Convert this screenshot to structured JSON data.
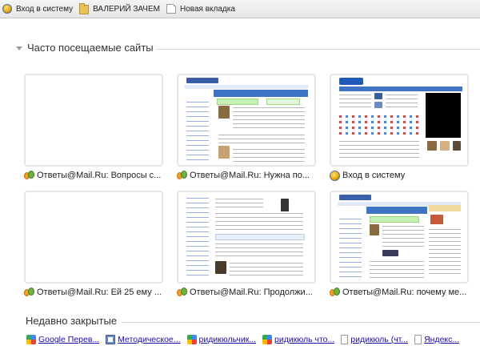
{
  "bookmarks": [
    {
      "label": "Вход в систему",
      "icon": "login-icon"
    },
    {
      "label": "ВАЛЕРИЙ ЗАЧЕМ",
      "icon": "folder-icon"
    },
    {
      "label": "Новая вкладка",
      "icon": "page-icon"
    }
  ],
  "most_visited": {
    "title": "Часто посещаемые сайты",
    "tiles": [
      {
        "label": "Ответы@Mail.Ru: Вопросы с...",
        "icon": "otvety-icon",
        "thumb": "blank"
      },
      {
        "label": "Ответы@Mail.Ru: Нужна по...",
        "icon": "otvety-icon",
        "thumb": "otvety"
      },
      {
        "label": "Вход в систему",
        "icon": "login-icon",
        "thumb": "mailru"
      },
      {
        "label": "Ответы@Mail.Ru: Ей 25 ему ...",
        "icon": "otvety-icon",
        "thumb": "blank"
      },
      {
        "label": "Ответы@Mail.Ru: Продолжи...",
        "icon": "otvety-icon",
        "thumb": "otvety2"
      },
      {
        "label": "Ответы@Mail.Ru: почему ме...",
        "icon": "otvety-icon",
        "thumb": "otvety3"
      }
    ]
  },
  "recently_closed": {
    "title": "Недавно закрытые",
    "items": [
      {
        "label": "Google Перев...",
        "icon": "google-icon"
      },
      {
        "label": "Методическое...",
        "icon": "document-icon"
      },
      {
        "label": "ридикюльчик...",
        "icon": "google-icon"
      },
      {
        "label": "ридикюль что...",
        "icon": "google-icon"
      },
      {
        "label": "ридикюль (чт...",
        "icon": "page-icon"
      },
      {
        "label": "Яндекс...",
        "icon": "page-icon"
      }
    ]
  },
  "colors": {
    "accent_blue": "#3f73c4",
    "link": "#1a0dab",
    "tile_border": "#e6e6e6"
  }
}
